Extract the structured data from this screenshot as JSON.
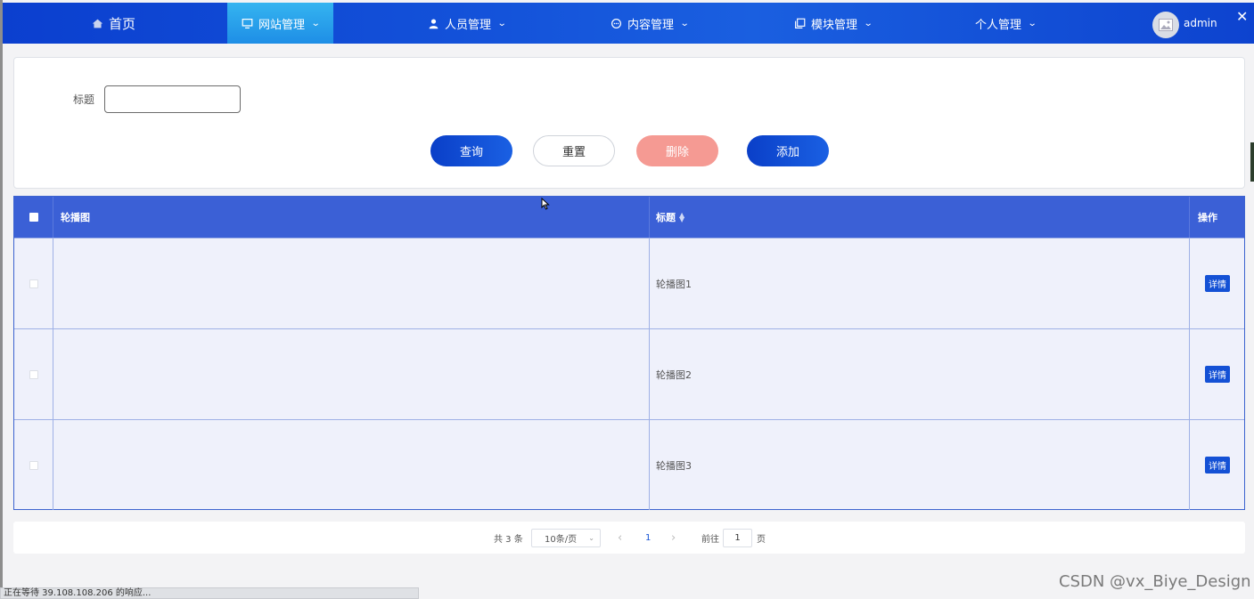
{
  "nav": {
    "home": "首页",
    "items": [
      {
        "label": "网站管理"
      },
      {
        "label": "人员管理"
      },
      {
        "label": "内容管理"
      },
      {
        "label": "模块管理"
      },
      {
        "label": "个人管理"
      }
    ],
    "user": "admin"
  },
  "search": {
    "title_label": "标题",
    "title_value": "",
    "buttons": {
      "query": "查询",
      "reset": "重置",
      "delete": "删除",
      "add": "添加"
    }
  },
  "table": {
    "headers": {
      "image": "轮播图",
      "title": "标题",
      "op": "操作"
    },
    "rows": [
      {
        "title": "轮播图1",
        "action": "详情"
      },
      {
        "title": "轮播图2",
        "action": "详情"
      },
      {
        "title": "轮播图3",
        "action": "详情"
      }
    ]
  },
  "pagination": {
    "total": "共 3 条",
    "page_size": "10条/页",
    "prev": "‹",
    "current_page": "1",
    "next": "›",
    "goto_label": "前往",
    "goto_value": "1",
    "goto_suffix": "页"
  },
  "status_bar": "正在等待 39.108.108.206 的响应...",
  "watermark": "CSDN @vx_Biye_Design",
  "colors": {
    "nav": "#1453da",
    "header": "#3b60d6",
    "primary": "#1451d5",
    "danger": "#f59a93"
  }
}
